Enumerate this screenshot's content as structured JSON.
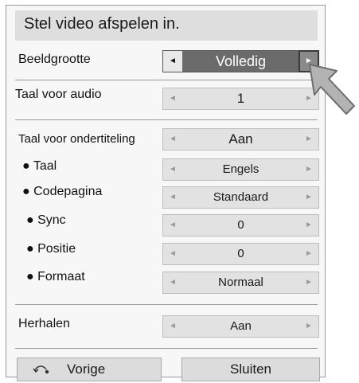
{
  "dialog": {
    "title": "Stel video afspelen in."
  },
  "settings": [
    {
      "label": "Beeldgrootte",
      "value": "Volledig"
    },
    {
      "label": "Taal voor audio",
      "value": "1"
    },
    {
      "label": "Taal voor ondertiteling",
      "value": "Aan"
    },
    {
      "label": "● Taal",
      "value": "Engels"
    },
    {
      "label": "● Codepagina",
      "value": "Standaard"
    },
    {
      "label": "● Sync",
      "value": "0"
    },
    {
      "label": "● Positie",
      "value": "0"
    },
    {
      "label": "● Formaat",
      "value": "Normaal"
    },
    {
      "label": "Herhalen",
      "value": "Aan"
    }
  ],
  "arrows": {
    "left": "◄",
    "right": "►"
  },
  "buttons": {
    "back": "Vorige",
    "close": "Sluiten"
  },
  "colors": {
    "panel": "#f7f7f7",
    "title_bar": "#dedede",
    "selected": "#6b6b6b",
    "control": "#e2e2e2"
  }
}
